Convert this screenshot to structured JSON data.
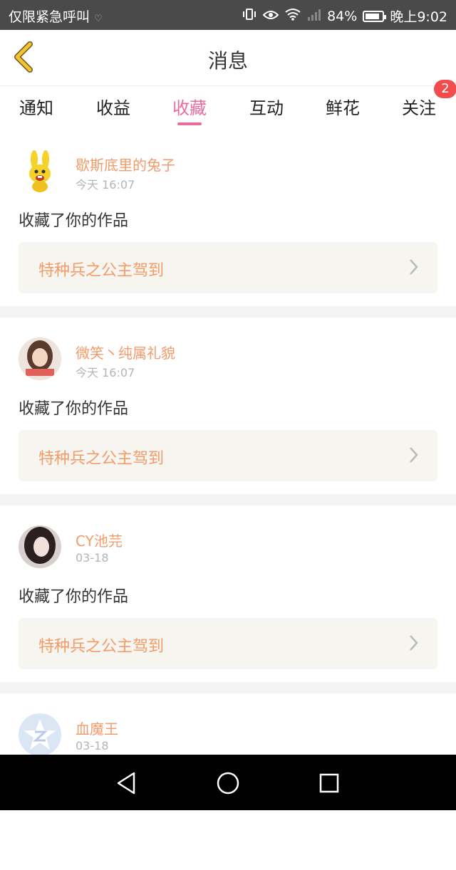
{
  "status_bar": {
    "carrier": "仅限紧急呼叫",
    "battery": "84%",
    "time": "晚上9:02"
  },
  "header": {
    "title": "消息"
  },
  "tabs": [
    {
      "label": "通知"
    },
    {
      "label": "收益"
    },
    {
      "label": "收藏",
      "active": true
    },
    {
      "label": "互动"
    },
    {
      "label": "鲜花"
    },
    {
      "label": "关注",
      "badge": "2"
    }
  ],
  "items": [
    {
      "user": "歇斯底里的兔子",
      "time": "今天 16:07",
      "action": "收藏了你的作品",
      "work": "特种兵之公主驾到"
    },
    {
      "user": "微笑丶纯属礼貌",
      "time": "今天 16:07",
      "action": "收藏了你的作品",
      "work": "特种兵之公主驾到"
    },
    {
      "user": "CY池芫",
      "time": "03-18",
      "action": "收藏了你的作品",
      "work": "特种兵之公主驾到"
    },
    {
      "user": "血魔王",
      "time": "03-18"
    }
  ],
  "colors": {
    "accent": "#ea6c9d",
    "username": "#f29b6b",
    "badge": "#f24c4c"
  }
}
